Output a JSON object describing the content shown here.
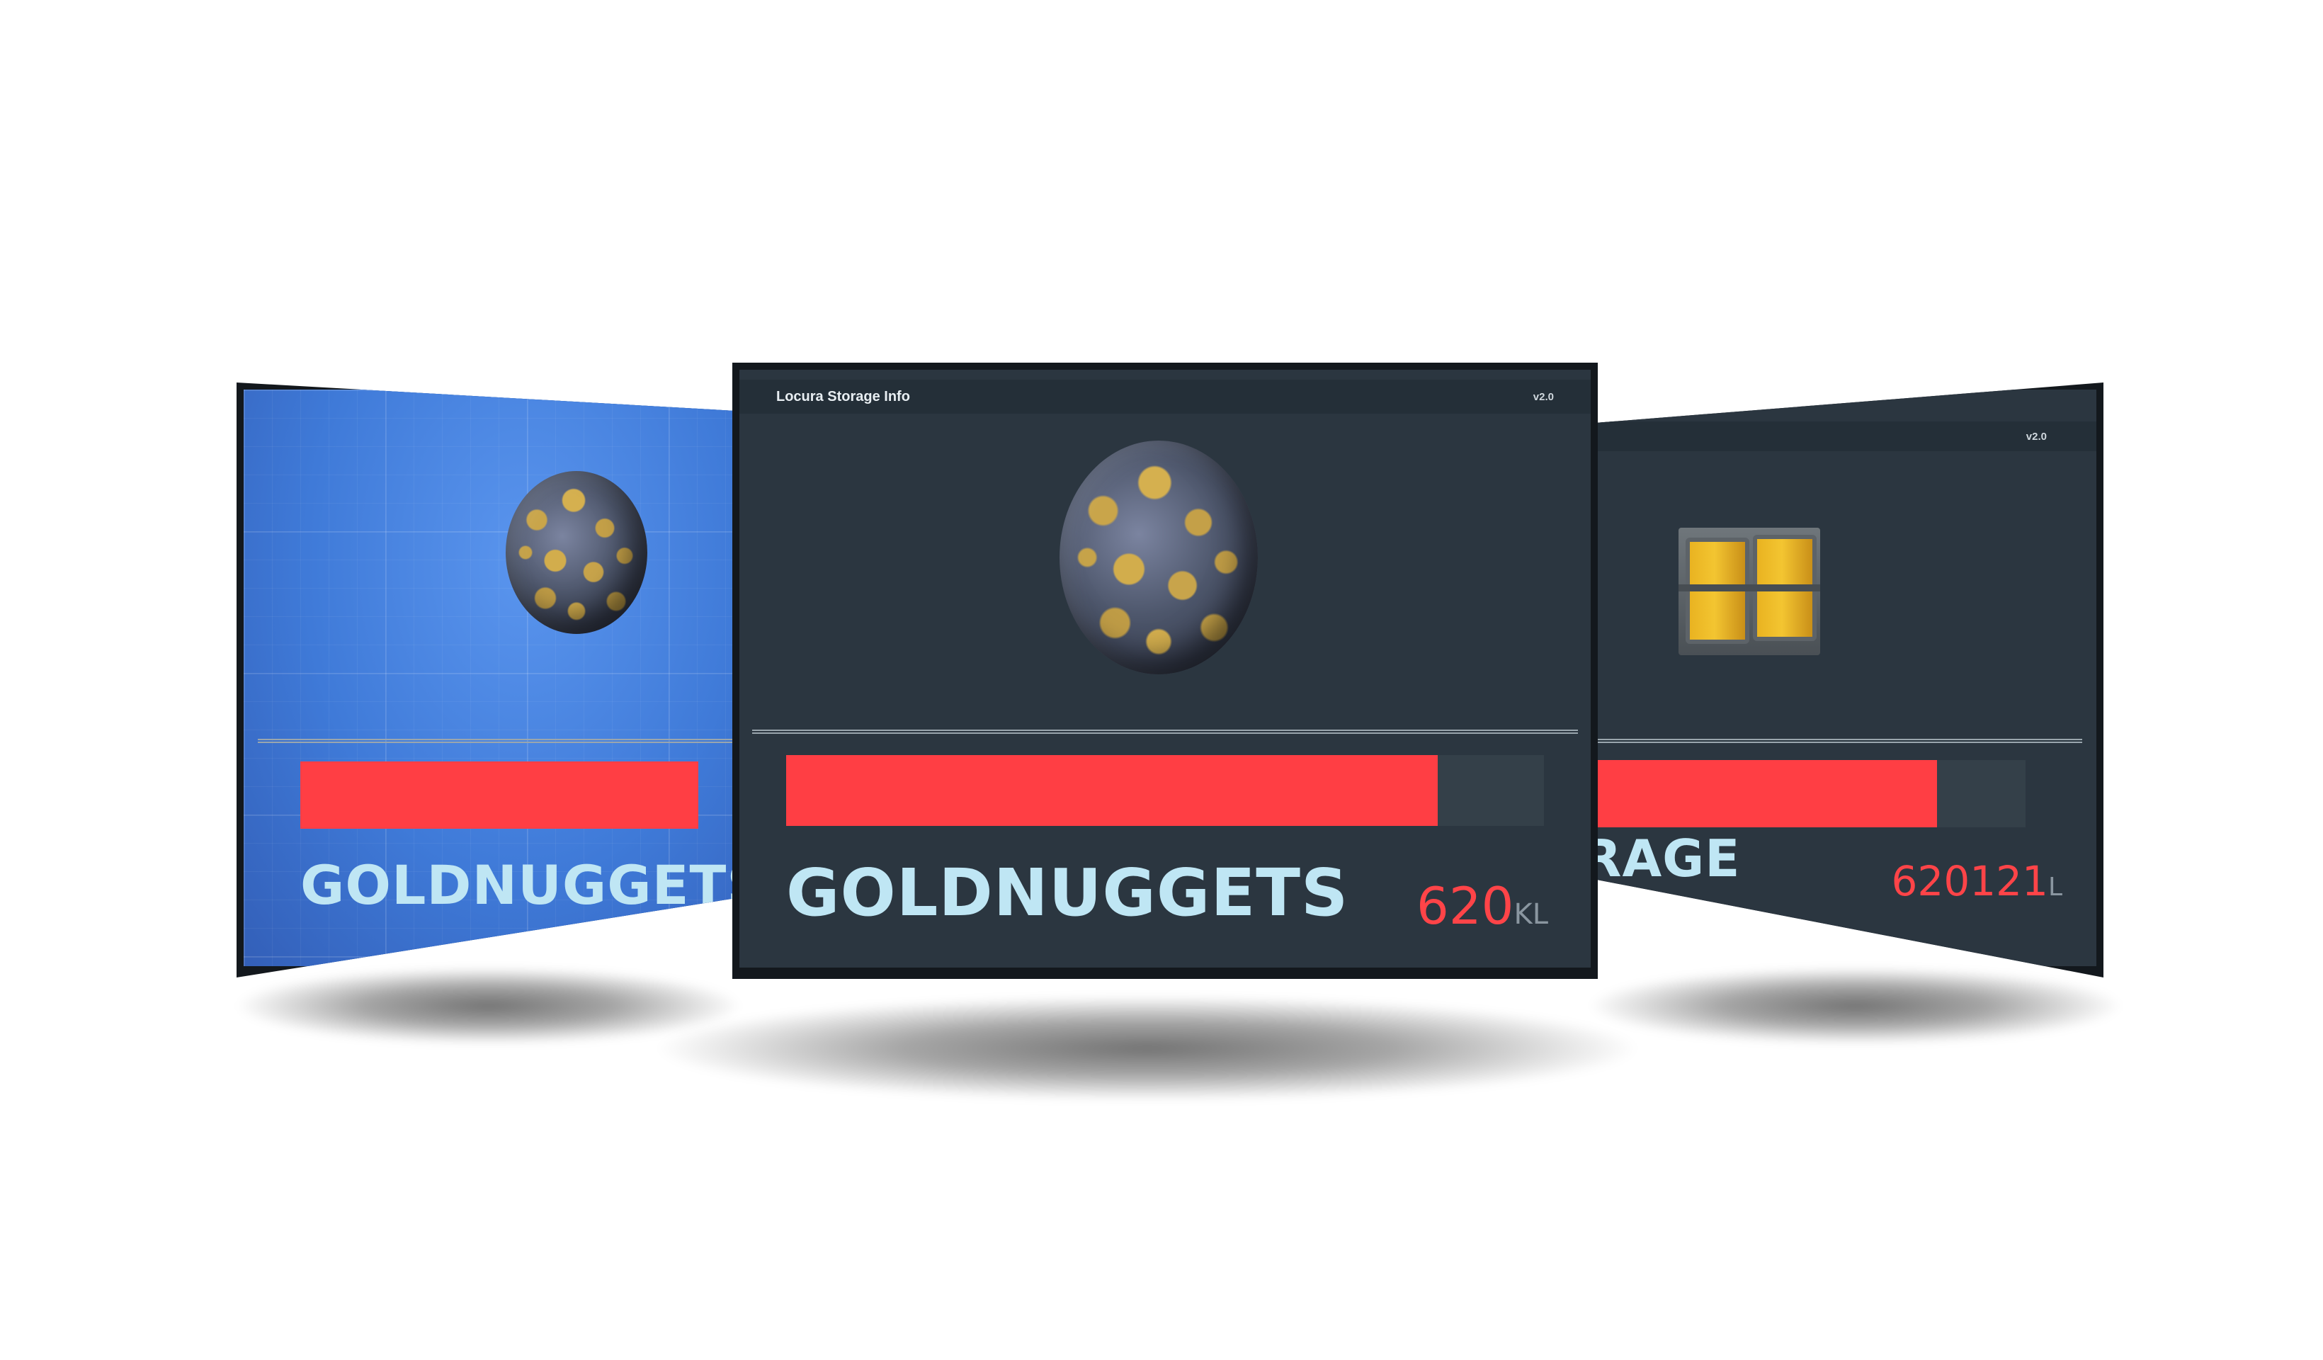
{
  "left_panel": {
    "item_name": "GOLDNUGGETS",
    "progress": 0.78
  },
  "center_panel": {
    "title": "Locura Storage Info",
    "version": "v2.0",
    "item_name": "GOLDNUGGETS",
    "amount_value": "620",
    "amount_unit": "KL",
    "progress": 0.86
  },
  "right_panel": {
    "version": "v2.0",
    "item_name_visible": "RAGE",
    "amount_value": "620121",
    "amount_unit": "L",
    "progress": 0.81
  },
  "colors": {
    "bar_fill": "#ff3e44",
    "bar_track": "#344049",
    "screen_dark": "#2b3640",
    "screen_blue": "#3f7ad8",
    "item_text": "#bfe6f4",
    "amount_text": "#ff4448"
  },
  "icons": {
    "left_item": "gold-ore-sphere-icon",
    "center_item": "gold-ore-sphere-icon",
    "right_item": "storage-crate-icon"
  }
}
